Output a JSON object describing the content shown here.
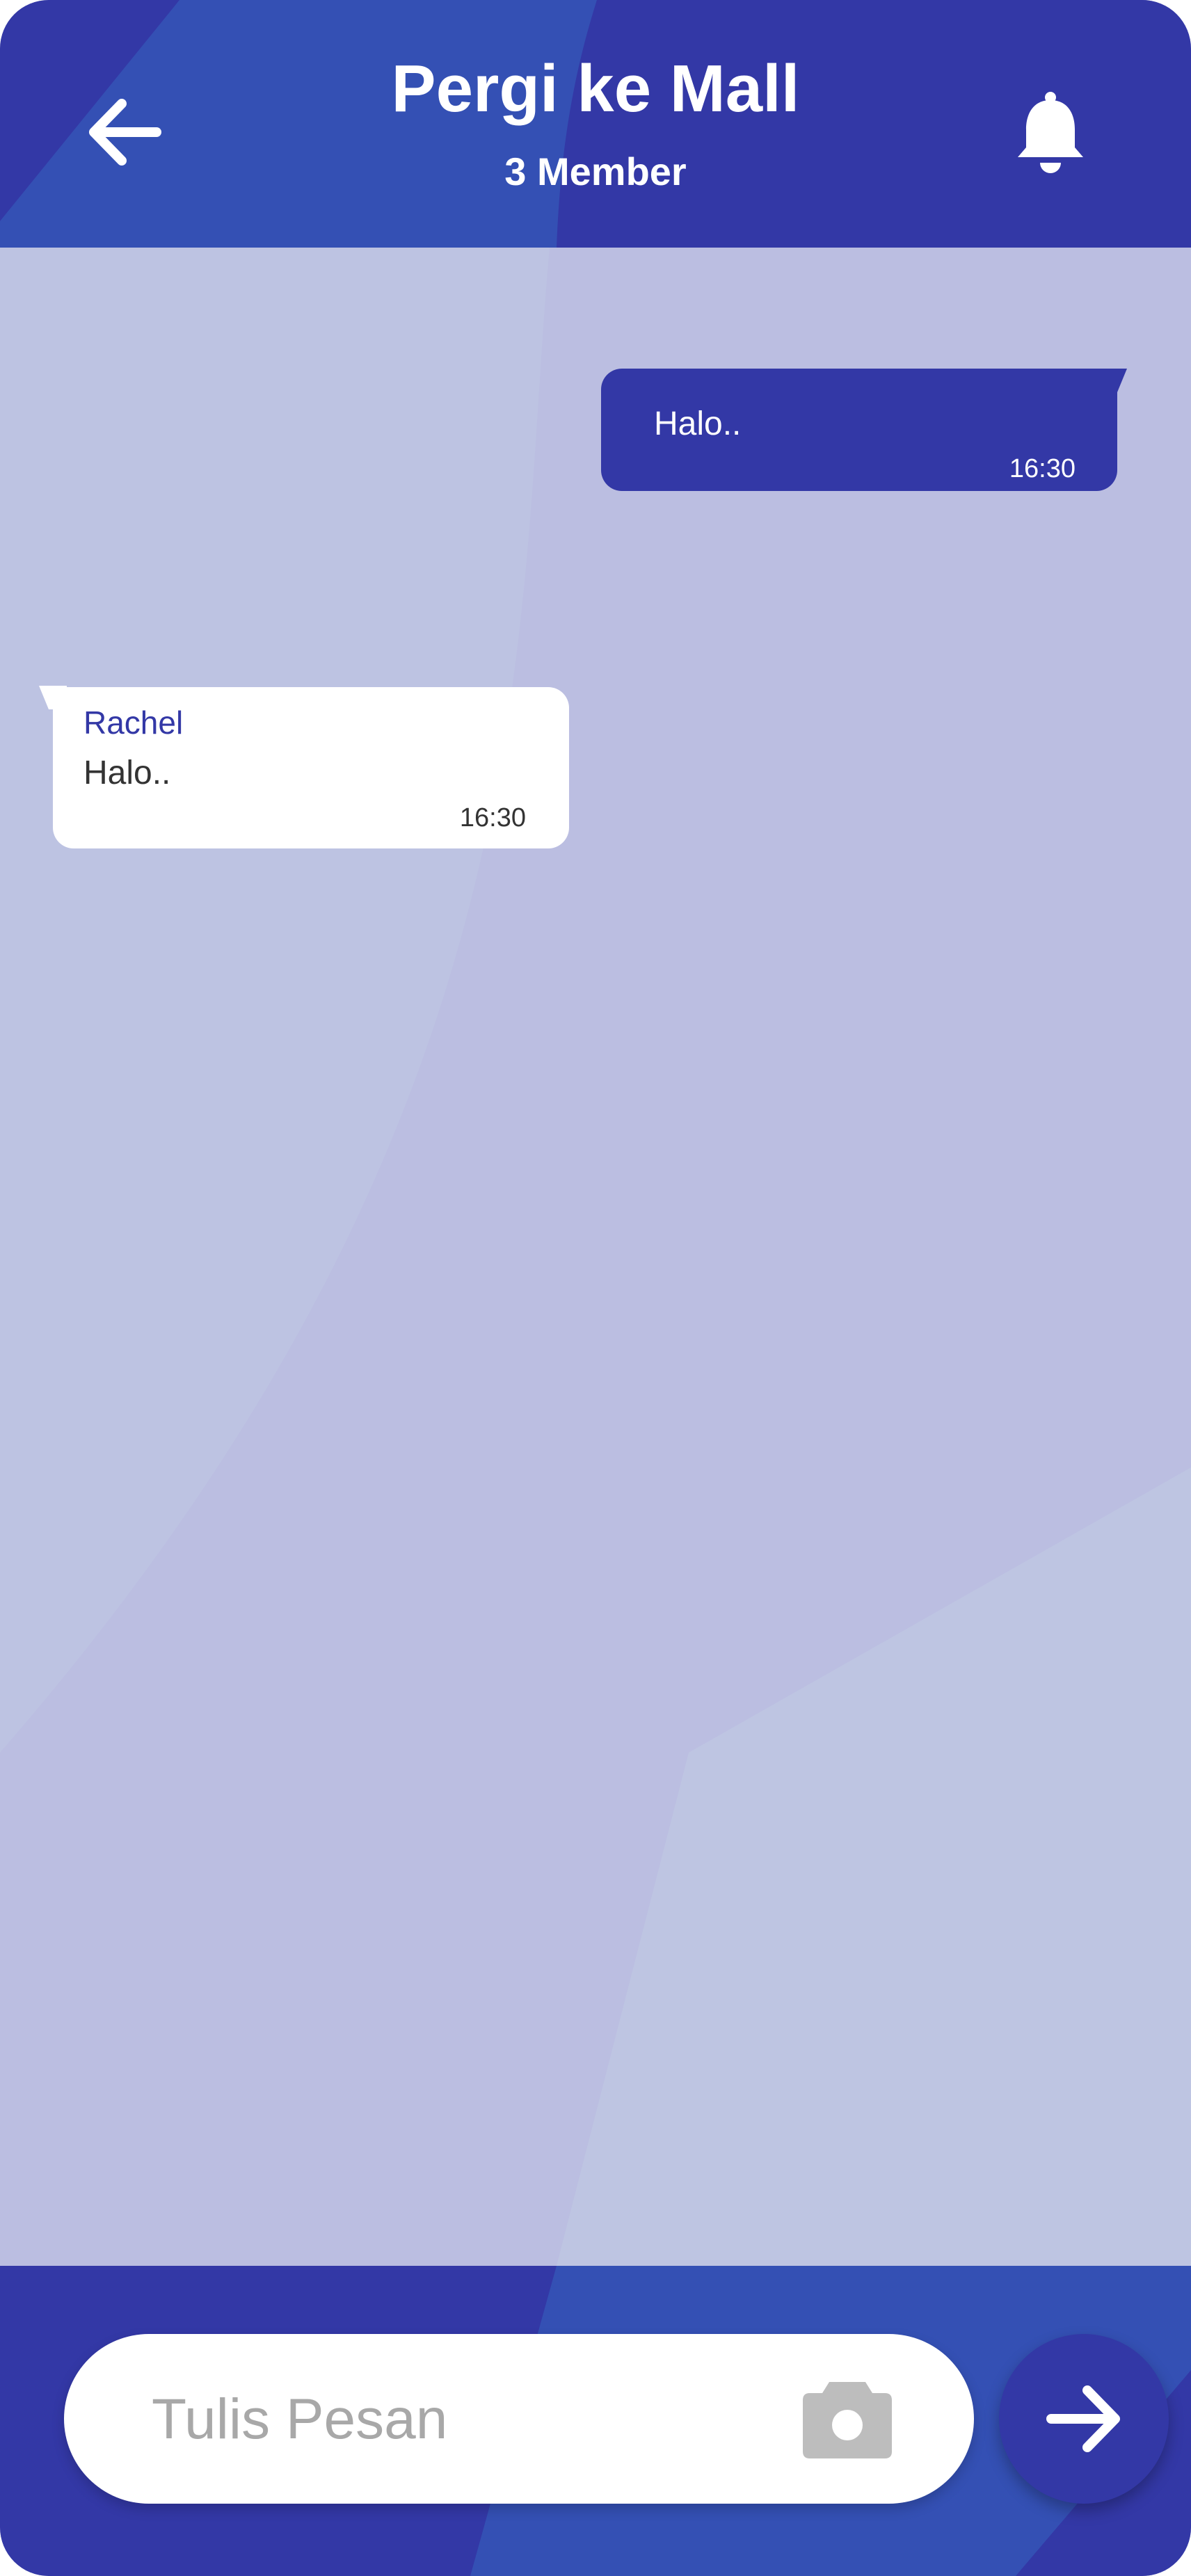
{
  "header": {
    "title": "Pergi ke Mall",
    "subtitle": "3 Member",
    "back_icon": "arrow-left-icon",
    "notification_icon": "bell-icon"
  },
  "messages": [
    {
      "direction": "outgoing",
      "text": "Halo..",
      "time": "16:30"
    },
    {
      "direction": "incoming",
      "sender": "Rachel",
      "text": "Halo..",
      "time": "16:30"
    }
  ],
  "composer": {
    "placeholder": "Tulis Pesan",
    "value": "",
    "camera_icon": "camera-icon",
    "send_icon": "arrow-right-icon"
  },
  "colors": {
    "primary": "#3338a6",
    "accent_light": "#3450b4",
    "chat_background": "#bec3e2",
    "incoming_bubble": "#ffffff",
    "placeholder": "#a8a8a8"
  }
}
